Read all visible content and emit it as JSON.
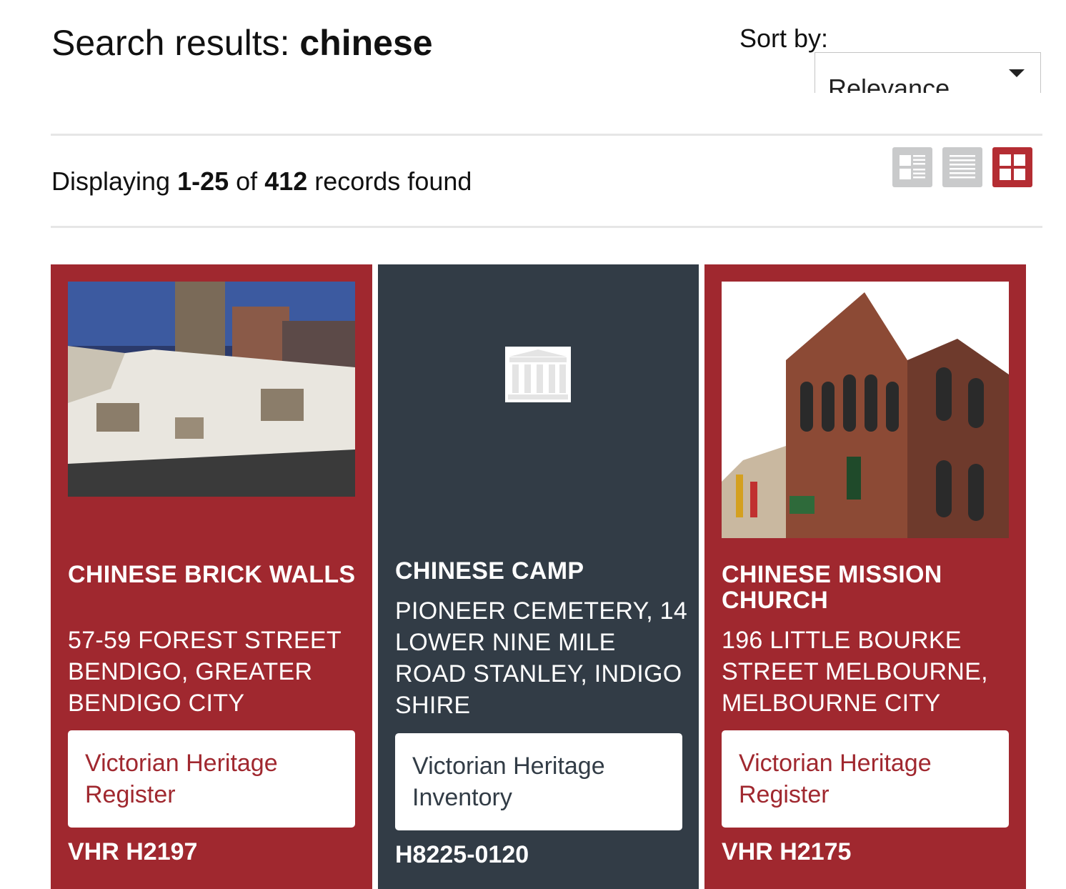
{
  "header": {
    "title_prefix": "Search results: ",
    "search_term": "chinese",
    "sort_label": "Sort by:",
    "sort_value": "Relevance"
  },
  "results": {
    "prefix": "Displaying ",
    "range": "1-25",
    "of_label": " of ",
    "total": "412",
    "suffix": " records found"
  },
  "view_toggles": [
    {
      "icon": "list-with-thumbnails-icon",
      "active": false
    },
    {
      "icon": "list-icon",
      "active": false
    },
    {
      "icon": "grid-icon",
      "active": true
    }
  ],
  "cards": [
    {
      "title": "CHINESE BRICK WALLS",
      "address": "57-59 FOREST STREET BENDIGO, GREATER BENDIGO CITY",
      "register": "Victorian Heritage Register",
      "id": "VHR H2197",
      "color": "#a0282f"
    },
    {
      "title": "CHINESE CAMP",
      "address": "PIONEER CEMETERY, 14 LOWER NINE MILE ROAD STANLEY, INDIGO SHIRE",
      "register": "Victorian Heritage Inventory",
      "id": "H8225-0120",
      "color": "#323c46"
    },
    {
      "title": "CHINESE MISSION CHURCH",
      "address": "196 LITTLE BOURKE STREET MELBOURNE, MELBOURNE CITY",
      "register": "Victorian Heritage Register",
      "id": "VHR H2175",
      "color": "#a0282f"
    }
  ]
}
